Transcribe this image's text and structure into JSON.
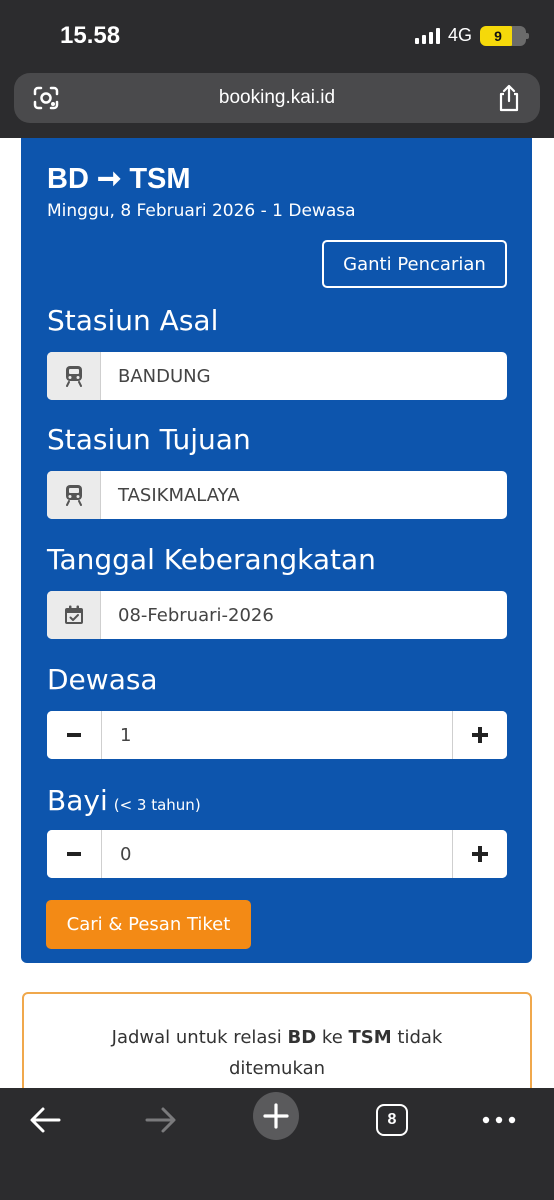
{
  "status_bar": {
    "time": "15.58",
    "network": "4G",
    "battery": "9"
  },
  "browser": {
    "url": "booking.kai.id",
    "tab_count": "8"
  },
  "header": {
    "route_from": "BD",
    "route_arrow": "➞",
    "route_to": "TSM",
    "trip_info": "Minggu, 8 Februari 2026 - 1 Dewasa",
    "change_search_label": "Ganti Pencarian"
  },
  "form": {
    "origin": {
      "label": "Stasiun Asal",
      "value": "BANDUNG",
      "icon": "train-icon"
    },
    "destination": {
      "label": "Stasiun Tujuan",
      "value": "TASIKMALAYA",
      "icon": "train-icon"
    },
    "date": {
      "label": "Tanggal Keberangkatan",
      "value": "08-Februari-2026",
      "icon": "calendar-check-icon"
    },
    "adult": {
      "label": "Dewasa",
      "value": "1"
    },
    "infant": {
      "label": "Bayi",
      "note": "(< 3 tahun)",
      "value": "0"
    },
    "submit_label": "Cari & Pesan Tiket"
  },
  "notice": {
    "prefix": "Jadwal untuk relasi ",
    "from": "BD",
    "middle": " ke ",
    "to": "TSM",
    "suffix": " tidak ditemukan"
  },
  "colors": {
    "card_blue": "#0d55ad",
    "button_orange": "#f38a15",
    "notice_border": "#f0a84c",
    "chrome_dark": "#2c2c2e",
    "battery_yellow": "#f5d90a"
  }
}
